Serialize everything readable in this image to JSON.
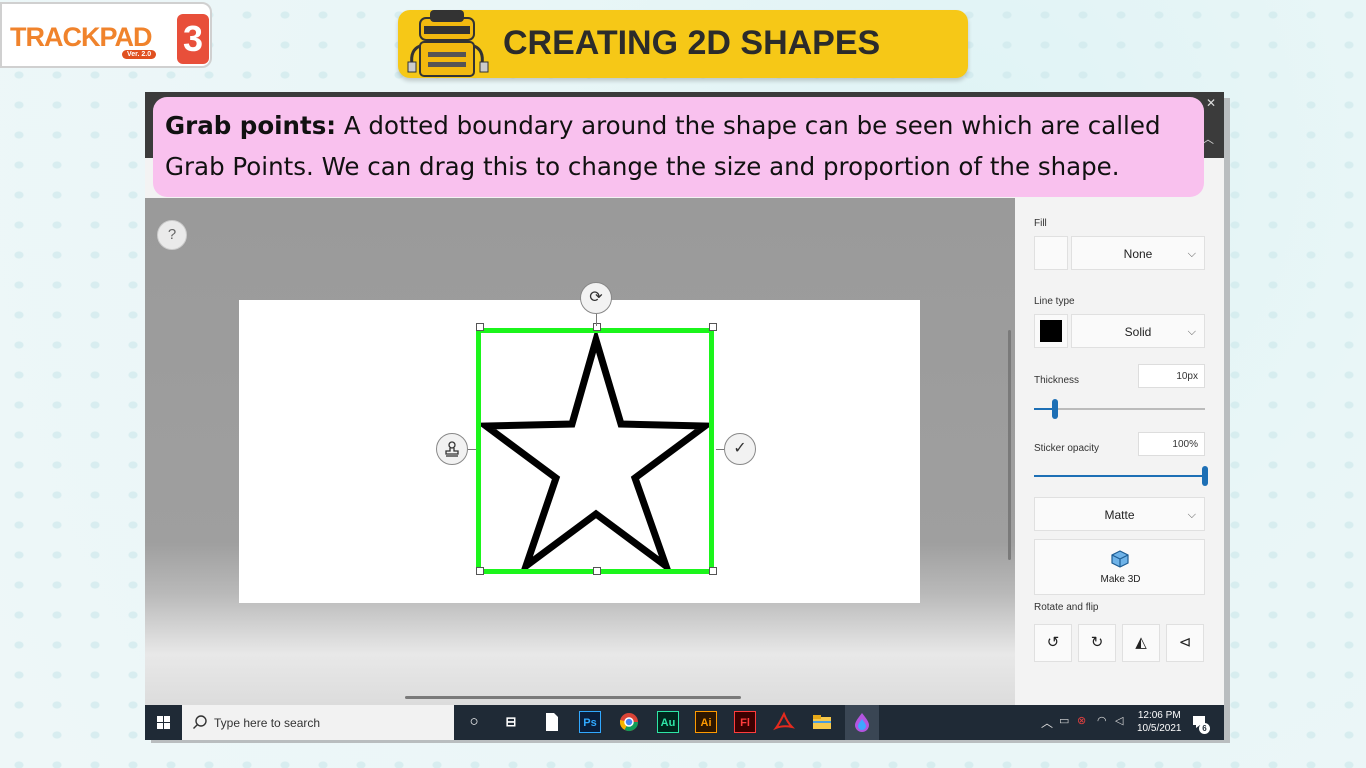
{
  "logo": {
    "text": "TRACKPAD",
    "version": "Ver. 2.0",
    "badge": "3"
  },
  "banner": {
    "title": "CREATING 2D SHAPES"
  },
  "callout": {
    "bold": "Grab points:",
    "text": " A dotted boundary around the shape can be seen which are called Grab Points. We can drag this to change the size and proportion of the shape."
  },
  "workspace": {
    "help_label": "?"
  },
  "panel": {
    "fill_label": "Fill",
    "fill_value": "None",
    "line_type_label": "Line type",
    "line_type_value": "Solid",
    "line_color": "#000000",
    "thickness_label": "Thickness",
    "thickness_value": "10px",
    "thickness_level": 0.12,
    "opacity_label": "Sticker opacity",
    "opacity_value": "100%",
    "opacity_level": 1.0,
    "finish_value": "Matte",
    "make3d_label": "Make 3D",
    "rotate_label": "Rotate and flip"
  },
  "selection": {
    "border_color": "#1bf51b"
  },
  "taskbar": {
    "search_placeholder": "Type here to search",
    "apps": [
      "Ps",
      "Au",
      "Ai",
      "Fl"
    ],
    "time": "12:06 PM",
    "date": "10/5/2021",
    "notification_count": "6"
  }
}
